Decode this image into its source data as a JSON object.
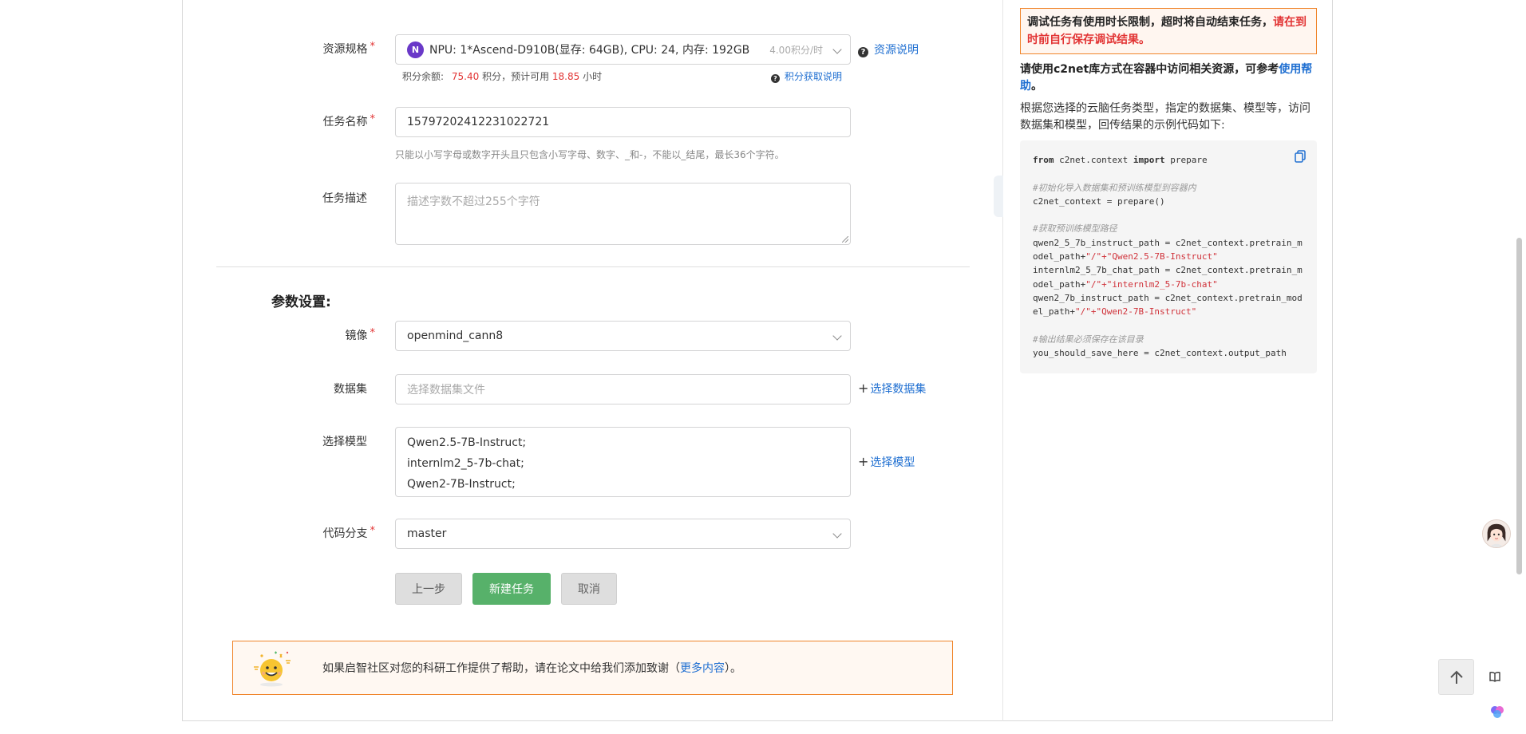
{
  "form": {
    "resource": {
      "label": "资源规格",
      "badge": "N",
      "value": "NPU: 1*Ascend-D910B(显存: 64GB), CPU: 24, 内存: 192GB",
      "cost": "4.00积分/时",
      "help_link": "资源说明",
      "balance_prefix": "积分余额:",
      "balance_value": "75.40",
      "balance_mid": "积分，预计可用",
      "hours_value": "18.85",
      "hours_suffix": "小时",
      "points_help": "积分获取说明"
    },
    "task_name": {
      "label": "任务名称",
      "value": "15797202412231022721",
      "hint": "只能以小写字母或数字开头且只包含小写字母、数字、_和-，不能以_结尾，最长36个字符。"
    },
    "task_desc": {
      "label": "任务描述",
      "placeholder": "描述字数不超过255个字符"
    }
  },
  "params": {
    "title": "参数设置:",
    "image": {
      "label": "镜像",
      "value": "openmind_cann8"
    },
    "dataset": {
      "label": "数据集",
      "placeholder": "选择数据集文件",
      "action": "选择数据集"
    },
    "model": {
      "label": "选择模型",
      "items": [
        "Qwen2.5-7B-Instruct;",
        "internlm2_5-7b-chat;",
        "Qwen2-7B-Instruct;"
      ],
      "action": "选择模型"
    },
    "branch": {
      "label": "代码分支",
      "value": "master"
    }
  },
  "buttons": {
    "prev": "上一步",
    "create": "新建任务",
    "cancel": "取消"
  },
  "thanks": {
    "text_before": "如果启智社区对您的科研工作提供了帮助，请在论文中给我们添加致谢（",
    "link": "更多内容",
    "text_after": "）。"
  },
  "right_panel": {
    "warning_black": "调试任务有使用时长限制，超时将自动结束任务，",
    "warning_red": "请在到时前自行保存调试结果。",
    "c2net_text": "请使用c2net库方式在容器中访问相关资源，可参考",
    "c2net_link": "使用帮助",
    "c2net_end": "。",
    "desc": "根据您选择的云脑任务类型，指定的数据集、模型等，访问数据集和模型，回传结果的示例代码如下:",
    "code": {
      "l1_kw1": "from",
      "l1_mid": " c2net.context ",
      "l1_kw2": "import",
      "l1_end": " prepare",
      "c1": "#初始化导入数据集和预训练模型到容器内",
      "l2": "c2net_context = prepare()",
      "c2": "#获取预训练模型路径",
      "l3a": "qwen2_5_7b_instruct_path = c2net_context.pretrain_m",
      "l3b": "odel_path+",
      "l3s": "\"/\"+\"Qwen2.5-7B-Instruct\"",
      "l4a": "internlm2_5_7b_chat_path = c2net_context.pretrain_m",
      "l4b": "odel_path+",
      "l4s": "\"/\"+\"internlm2_5-7b-chat\"",
      "l5a": "qwen2_7b_instruct_path = c2net_context.pretrain_mod",
      "l5b": "el_path+",
      "l5s": "\"/\"+\"Qwen2-7B-Instruct\"",
      "c3": "#输出结果必须保存在该目录",
      "l6": "you_should_save_here = c2net_context.output_path"
    }
  },
  "colors": {
    "primary_link": "#1f6fd1",
    "create_button": "#57b16a",
    "required": "#e23434",
    "warning_border": "#f0852b"
  }
}
